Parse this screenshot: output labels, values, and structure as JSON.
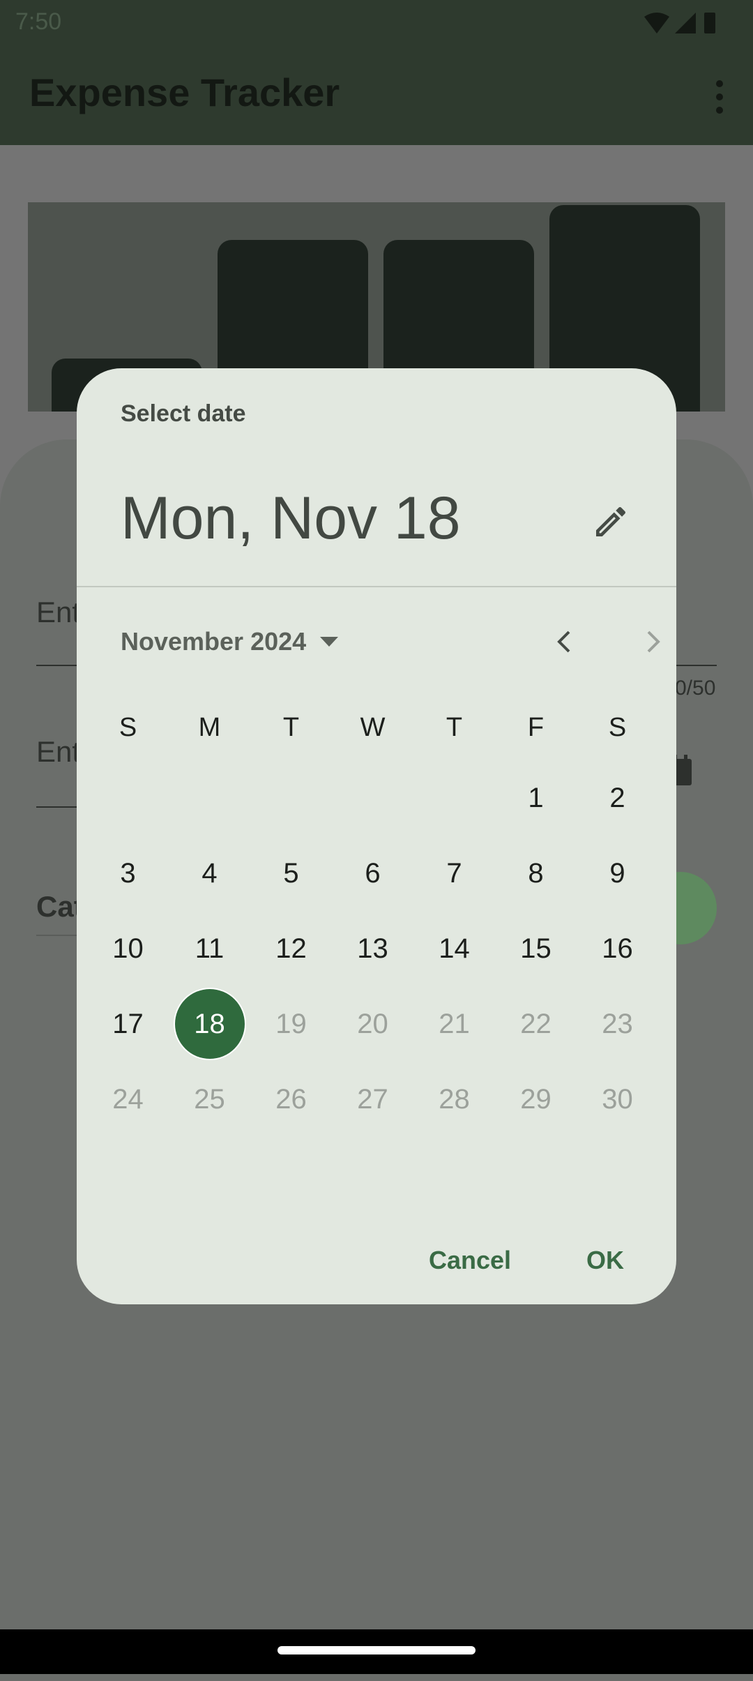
{
  "status_bar": {
    "time": "7:50",
    "icons": [
      "wifi-icon",
      "signal-icon",
      "battery-icon"
    ]
  },
  "app_bar": {
    "title": "Expense Tracker",
    "overflow_icon": "more-vert-icon"
  },
  "background_form": {
    "field1_partial": "Ent",
    "field2_partial": "Ent",
    "counter_partial": "0/50",
    "category_partial": "Cat"
  },
  "date_picker": {
    "headline": "Select date",
    "selected_date": "Mon, Nov 18",
    "month_label": "November 2024",
    "weekdays": [
      "S",
      "M",
      "T",
      "W",
      "T",
      "F",
      "S"
    ],
    "days": [
      "",
      "",
      "",
      "",
      "",
      "1",
      "2",
      "3",
      "4",
      "5",
      "6",
      "7",
      "8",
      "9",
      "10",
      "11",
      "12",
      "13",
      "14",
      "15",
      "16",
      "17",
      "18",
      "19",
      "20",
      "21",
      "22",
      "23",
      "24",
      "25",
      "26",
      "27",
      "28",
      "29",
      "30"
    ],
    "selected_day": "18",
    "disabled_days": [
      "19",
      "20",
      "21",
      "22",
      "23",
      "24",
      "25",
      "26",
      "27",
      "28",
      "29",
      "30"
    ],
    "cancel_label": "Cancel",
    "ok_label": "OK"
  },
  "colors": {
    "accent": "#2f6a3d",
    "dialog_bg": "#e2e8e0",
    "scrim": "#747474"
  }
}
